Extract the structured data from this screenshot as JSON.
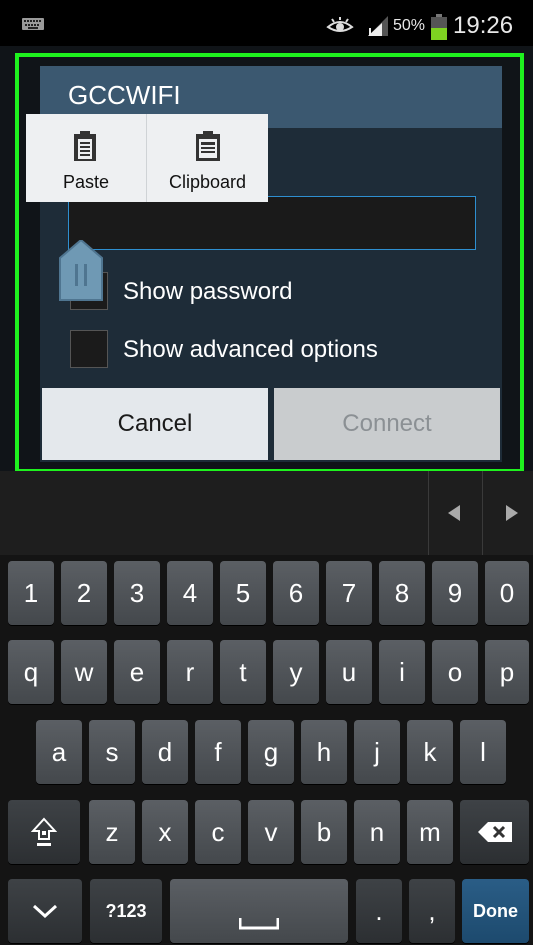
{
  "status_bar": {
    "battery_percent": "50%",
    "time": "19:26",
    "icons": [
      "keyboard-notification-icon",
      "smart-stay-eye-icon",
      "signal-strength-icon",
      "battery-icon"
    ]
  },
  "dialog": {
    "title": "GCCWIFI",
    "password_value": "",
    "show_password_label": "Show password",
    "show_advanced_label": "Show advanced options",
    "cancel_label": "Cancel",
    "connect_label": "Connect"
  },
  "popup": {
    "paste_label": "Paste",
    "clipboard_label": "Clipboard"
  },
  "colors": {
    "highlight": "#1ef21e",
    "dialog_header": "#3b5870",
    "dialog_body": "#1e2c38",
    "field_border": "#2e8fd0",
    "done_key": "#2a5d86"
  },
  "keyboard": {
    "row1": [
      "1",
      "2",
      "3",
      "4",
      "5",
      "6",
      "7",
      "8",
      "9",
      "0"
    ],
    "row2": [
      "q",
      "w",
      "e",
      "r",
      "t",
      "y",
      "u",
      "i",
      "o",
      "p"
    ],
    "row3": [
      "a",
      "s",
      "d",
      "f",
      "g",
      "h",
      "j",
      "k",
      "l"
    ],
    "row4": [
      "z",
      "x",
      "c",
      "v",
      "b",
      "n",
      "m"
    ],
    "symbols_label": "?123",
    "period_label": ".",
    "comma_label": ",",
    "done_label": "Done"
  }
}
